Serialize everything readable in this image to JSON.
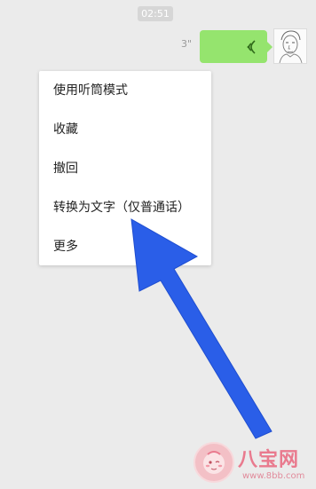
{
  "chat": {
    "time": "02:51",
    "voice_duration": "3\""
  },
  "context_menu": {
    "items": [
      {
        "label": "使用听筒模式"
      },
      {
        "label": "收藏"
      },
      {
        "label": "撤回"
      },
      {
        "label": "转换为文字（仅普通话）"
      },
      {
        "label": "更多"
      }
    ]
  },
  "watermark": {
    "title": "八宝网",
    "url": "www.8bb.com"
  },
  "colors": {
    "bubble": "#95e46e",
    "arrow": "#2a5ee8",
    "chat_background": "#ebebeb",
    "menu_background": "#ffffff"
  },
  "icons": {
    "voice": "voice-wave-icon",
    "avatar": "sketch-portrait-avatar",
    "arrow": "pointer-arrow-icon"
  }
}
